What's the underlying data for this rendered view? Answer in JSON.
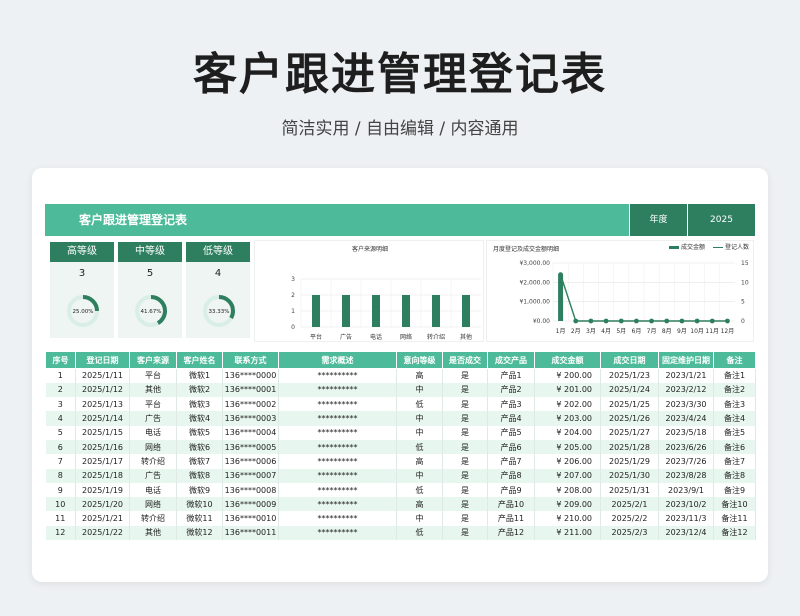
{
  "hero": {
    "title": "客户跟进管理登记表",
    "subtitle": "简洁实用 / 自由编辑 / 内容通用"
  },
  "banner": {
    "title": "客户跟进管理登记表",
    "year_label": "年度",
    "year": "2025"
  },
  "levels": [
    {
      "label": "高等级",
      "count": "3",
      "percent_text": "25.00%",
      "percent": 0.25
    },
    {
      "label": "中等级",
      "count": "5",
      "percent_text": "41.67%",
      "percent": 0.4167
    },
    {
      "label": "低等级",
      "count": "4",
      "percent_text": "33.33%",
      "percent": 0.3333
    }
  ],
  "colors": {
    "primary": "#4dbb99",
    "dark": "#2e7f5f",
    "light_row": "#e7f6ef",
    "ring_track": "#d9eee6"
  },
  "chart_data": [
    {
      "type": "bar",
      "title": "客户来源明细",
      "categories": [
        "平台",
        "广告",
        "电话",
        "网络",
        "转介绍",
        "其他"
      ],
      "values": [
        2,
        2,
        2,
        2,
        2,
        2
      ],
      "ylim": [
        0,
        3
      ],
      "yticks": [
        "0",
        "1",
        "2",
        "3"
      ],
      "grid": true
    },
    {
      "type": "bar+line",
      "title": "月度登记及成交金额明细",
      "categories": [
        "1月",
        "2月",
        "3月",
        "4月",
        "5月",
        "6月",
        "7月",
        "8月",
        "9月",
        "10月",
        "11月",
        "12月"
      ],
      "series": [
        {
          "name": "成交金额",
          "type": "bar",
          "values": [
            2411,
            0,
            0,
            0,
            0,
            0,
            0,
            0,
            0,
            0,
            0,
            0
          ]
        },
        {
          "name": "登记人数",
          "type": "line",
          "values": [
            12,
            0,
            0,
            0,
            0,
            0,
            0,
            0,
            0,
            0,
            0,
            0
          ]
        }
      ],
      "y_left_ticks": [
        "¥0.00",
        "¥1,000.00",
        "¥2,000.00",
        "¥3,000.00"
      ],
      "y_left_lim": [
        0,
        3000
      ],
      "y_right_ticks": [
        "0",
        "5",
        "10",
        "15"
      ],
      "y_right_lim": [
        0,
        15
      ],
      "legend_position": "top-right"
    }
  ],
  "table": {
    "headers": [
      "序号",
      "登记日期",
      "客户来源",
      "客户姓名",
      "联系方式",
      "需求概述",
      "意向等级",
      "是否成交",
      "成交产品",
      "成交金额",
      "成交日期",
      "固定维护日期",
      "备注"
    ],
    "rows": [
      [
        "1",
        "2025/1/11",
        "平台",
        "微软1",
        "136****0000",
        "**********",
        "高",
        "是",
        "产品1",
        "¥ 200.00",
        "2025/1/23",
        "2023/1/21",
        "备注1"
      ],
      [
        "2",
        "2025/1/12",
        "其他",
        "微软2",
        "136****0001",
        "**********",
        "中",
        "是",
        "产品2",
        "¥ 201.00",
        "2025/1/24",
        "2023/2/12",
        "备注2"
      ],
      [
        "3",
        "2025/1/13",
        "平台",
        "微软3",
        "136****0002",
        "**********",
        "低",
        "是",
        "产品3",
        "¥ 202.00",
        "2025/1/25",
        "2023/3/30",
        "备注3"
      ],
      [
        "4",
        "2025/1/14",
        "广告",
        "微软4",
        "136****0003",
        "**********",
        "中",
        "是",
        "产品4",
        "¥ 203.00",
        "2025/1/26",
        "2023/4/24",
        "备注4"
      ],
      [
        "5",
        "2025/1/15",
        "电话",
        "微软5",
        "136****0004",
        "**********",
        "中",
        "是",
        "产品5",
        "¥ 204.00",
        "2025/1/27",
        "2023/5/18",
        "备注5"
      ],
      [
        "6",
        "2025/1/16",
        "网络",
        "微软6",
        "136****0005",
        "**********",
        "低",
        "是",
        "产品6",
        "¥ 205.00",
        "2025/1/28",
        "2023/6/26",
        "备注6"
      ],
      [
        "7",
        "2025/1/17",
        "转介绍",
        "微软7",
        "136****0006",
        "**********",
        "高",
        "是",
        "产品7",
        "¥ 206.00",
        "2025/1/29",
        "2023/7/26",
        "备注7"
      ],
      [
        "8",
        "2025/1/18",
        "广告",
        "微软8",
        "136****0007",
        "**********",
        "中",
        "是",
        "产品8",
        "¥ 207.00",
        "2025/1/30",
        "2023/8/28",
        "备注8"
      ],
      [
        "9",
        "2025/1/19",
        "电话",
        "微软9",
        "136****0008",
        "**********",
        "低",
        "是",
        "产品9",
        "¥ 208.00",
        "2025/1/31",
        "2023/9/1",
        "备注9"
      ],
      [
        "10",
        "2025/1/20",
        "网络",
        "微软10",
        "136****0009",
        "**********",
        "高",
        "是",
        "产品10",
        "¥ 209.00",
        "2025/2/1",
        "2023/10/2",
        "备注10"
      ],
      [
        "11",
        "2025/1/21",
        "转介绍",
        "微软11",
        "136****0010",
        "**********",
        "中",
        "是",
        "产品11",
        "¥ 210.00",
        "2025/2/2",
        "2023/11/3",
        "备注11"
      ],
      [
        "12",
        "2025/1/22",
        "其他",
        "微软12",
        "136****0011",
        "**********",
        "低",
        "是",
        "产品12",
        "¥ 211.00",
        "2025/2/3",
        "2023/12/4",
        "备注12"
      ]
    ]
  }
}
